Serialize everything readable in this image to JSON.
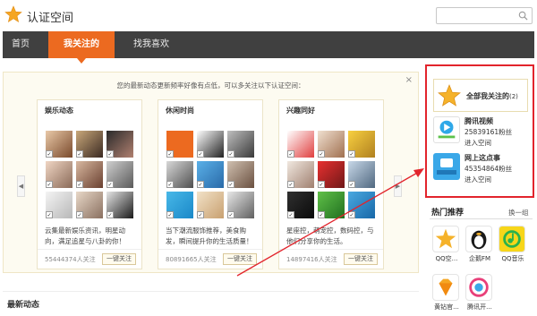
{
  "header": {
    "title": "认证空间",
    "search_placeholder": ""
  },
  "nav": {
    "items": [
      {
        "label": "首页"
      },
      {
        "label": "我关注的"
      },
      {
        "label": "找我喜欢"
      }
    ],
    "active_index": 1
  },
  "panel": {
    "tip": "您的最新动态更新频率好像有点低，可以多关注以下认证空间：",
    "close": "×",
    "prev": "◀",
    "next": "▶",
    "cards": [
      {
        "title": "娱乐动态",
        "desc": "云集最新娱乐资讯，明星动向，满足追星与八卦的你！",
        "count": "55444374人关注",
        "button": "一键关注"
      },
      {
        "title": "休闲时尚",
        "desc": "当下潮流服饰推荐，美食购发，瞬间提升你的生活质量！",
        "count": "80891665人关注",
        "button": "一键关注"
      },
      {
        "title": "兴趣同好",
        "desc": "星座控，萌宠控，数码控，与他们分享你的生活。",
        "count": "14897416人关注",
        "button": "一键关注"
      }
    ]
  },
  "follow_box": {
    "all_label": "全部我关注的",
    "all_count": "(2)",
    "items": [
      {
        "name": "腾讯视频",
        "fans": "25839161粉丝",
        "enter": "进入空间"
      },
      {
        "name": "网上这点事",
        "fans": "45354864粉丝",
        "enter": "进入空间"
      }
    ]
  },
  "hot": {
    "title": "热门推荐",
    "swap": "换一组",
    "items": [
      {
        "name": "QQ空..."
      },
      {
        "name": "企鹅FM"
      },
      {
        "name": "QQ音乐"
      },
      {
        "name": "黄钻官..."
      },
      {
        "name": "腾讯开..."
      }
    ]
  },
  "latest": {
    "title": "最新动态"
  },
  "colors": {
    "accent": "#ec6a20",
    "nav_bg": "#404040",
    "highlight": "#e2242c"
  }
}
